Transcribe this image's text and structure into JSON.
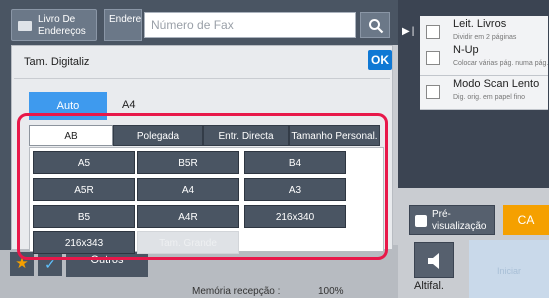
{
  "topbar": {
    "address_book_label": "Livro De Endereços",
    "destination_label": "Endereço",
    "fax_input_placeholder": "Número de Fax"
  },
  "right_options": [
    {
      "title": "Leit. Livros",
      "subtitle": "Dividir em 2 páginas"
    },
    {
      "title": "N-Up",
      "subtitle": "Colocar várias pág. numa pág."
    },
    {
      "title": "Modo Scan Lento",
      "subtitle": "Dig. orig. em papel fino"
    }
  ],
  "preview_label": "Pré-visualização",
  "ca_label": "CA",
  "volume_label": "Altifal.",
  "start_label": "Iniciar",
  "modal": {
    "title": "Tam. Digitaliz",
    "ok_label": "OK",
    "auto_label": "Auto",
    "current_size": "A4",
    "tabs": [
      "AB",
      "Polegada",
      "Entr. Directa",
      "Tamanho Personal."
    ],
    "active_tab": "AB",
    "sizes": [
      "A5",
      "B5R",
      "B4",
      "A5R",
      "A4",
      "A3",
      "B5",
      "A4R",
      "216x340",
      "216x343",
      "Tam. Grande"
    ]
  },
  "bottombar": {
    "others_label": "Outros",
    "memory_label": "Memória recepção :",
    "memory_value": "100%"
  },
  "colors": {
    "accent_blue": "#3e9aee",
    "ok_blue": "#0f78d4",
    "highlight_red": "#e8184a",
    "ca_orange": "#f5a000"
  }
}
